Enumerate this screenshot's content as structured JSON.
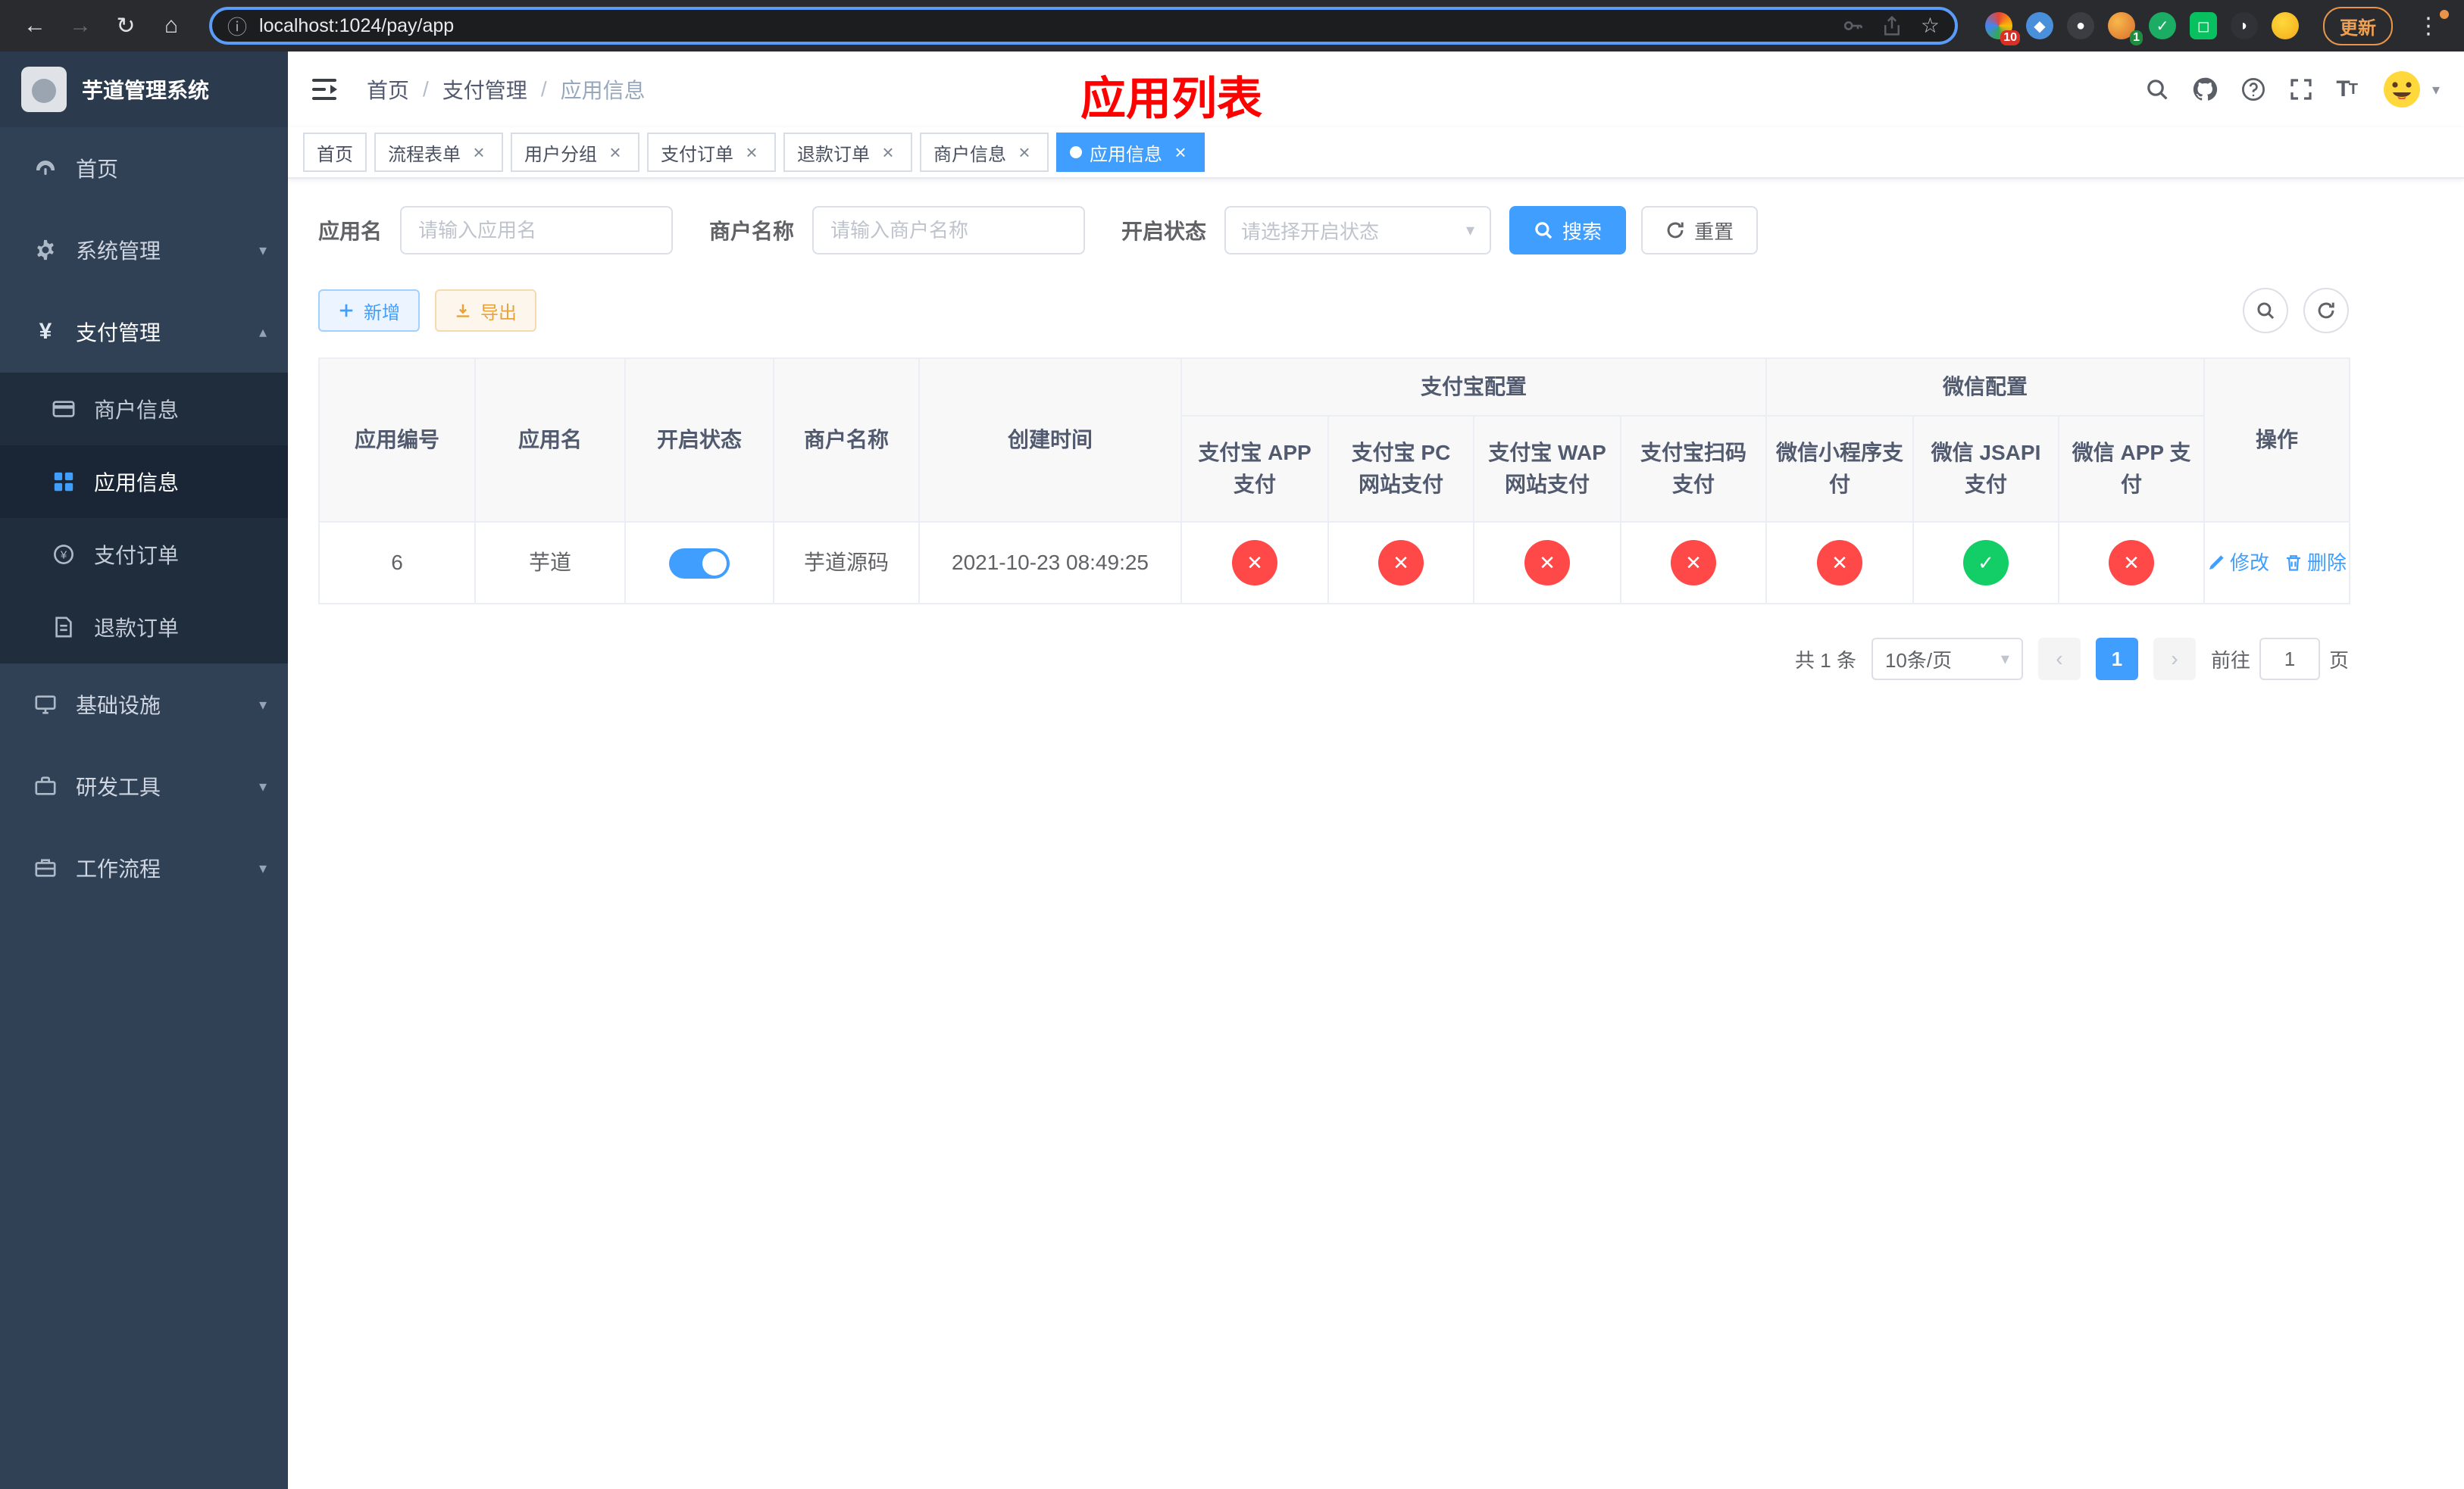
{
  "colors": {
    "accent": "#409eff",
    "status_off": "#ff4949",
    "status_on": "#13ce66",
    "sidebar_bg": "#304156",
    "submenu_bg": "#1f2d3d",
    "title_red": "#ff0000",
    "warning": "#e6a23c"
  },
  "browser": {
    "url": "localhost:1024/pay/app",
    "update_label": "更新",
    "ext_badges": {
      "first": "10",
      "second": "1"
    }
  },
  "sidebar": {
    "logo_title": "芋道管理系统",
    "menu": [
      {
        "label": "首页"
      },
      {
        "label": "系统管理"
      },
      {
        "label": "支付管理",
        "children": [
          {
            "label": "商户信息"
          },
          {
            "label": "应用信息"
          },
          {
            "label": "支付订单"
          },
          {
            "label": "退款订单"
          }
        ]
      },
      {
        "label": "基础设施"
      },
      {
        "label": "研发工具"
      },
      {
        "label": "工作流程"
      }
    ]
  },
  "header": {
    "breadcrumb": [
      "首页",
      "支付管理",
      "应用信息"
    ],
    "page_title": "应用列表"
  },
  "tabs": [
    {
      "label": "首页",
      "closable": false,
      "active": false
    },
    {
      "label": "流程表单",
      "closable": true,
      "active": false
    },
    {
      "label": "用户分组",
      "closable": true,
      "active": false
    },
    {
      "label": "支付订单",
      "closable": true,
      "active": false
    },
    {
      "label": "退款订单",
      "closable": true,
      "active": false
    },
    {
      "label": "商户信息",
      "closable": true,
      "active": false
    },
    {
      "label": "应用信息",
      "closable": true,
      "active": true
    }
  ],
  "filters": {
    "app_name": {
      "label": "应用名",
      "placeholder": "请输入应用名"
    },
    "merchant_name": {
      "label": "商户名称",
      "placeholder": "请输入商户名称"
    },
    "status": {
      "label": "开启状态",
      "placeholder": "请选择开启状态"
    },
    "search_label": "搜索",
    "reset_label": "重置"
  },
  "toolbar": {
    "add_label": "新增",
    "export_label": "导出"
  },
  "table": {
    "groups": {
      "alipay": "支付宝配置",
      "wechat": "微信配置"
    },
    "columns": {
      "id": "应用编号",
      "name": "应用名",
      "status": "开启状态",
      "merchant": "商户名称",
      "created": "创建时间",
      "alipay_app": "支付宝 APP 支付",
      "alipay_pc": "支付宝 PC 网站支付",
      "alipay_wap": "支付宝 WAP 网站支付",
      "alipay_qr": "支付宝扫码支付",
      "wx_mini": "微信小程序支付",
      "wx_jsapi": "微信 JSAPI 支付",
      "wx_app": "微信 APP 支付",
      "actions": "操作"
    },
    "rows": [
      {
        "id": "6",
        "name": "芋道",
        "status": "on",
        "merchant": "芋道源码",
        "created": "2021-10-23 08:49:25",
        "configs": {
          "alipay_app": "off",
          "alipay_pc": "off",
          "alipay_wap": "off",
          "alipay_qr": "off",
          "wx_mini": "off",
          "wx_jsapi": "on",
          "wx_app": "off"
        },
        "actions": {
          "edit": "修改",
          "delete": "删除"
        }
      }
    ]
  },
  "pagination": {
    "total": "共 1 条",
    "page_size": "10条/页",
    "current_page": "1",
    "goto_label": "前往",
    "goto_value": "1",
    "goto_unit": "页"
  }
}
